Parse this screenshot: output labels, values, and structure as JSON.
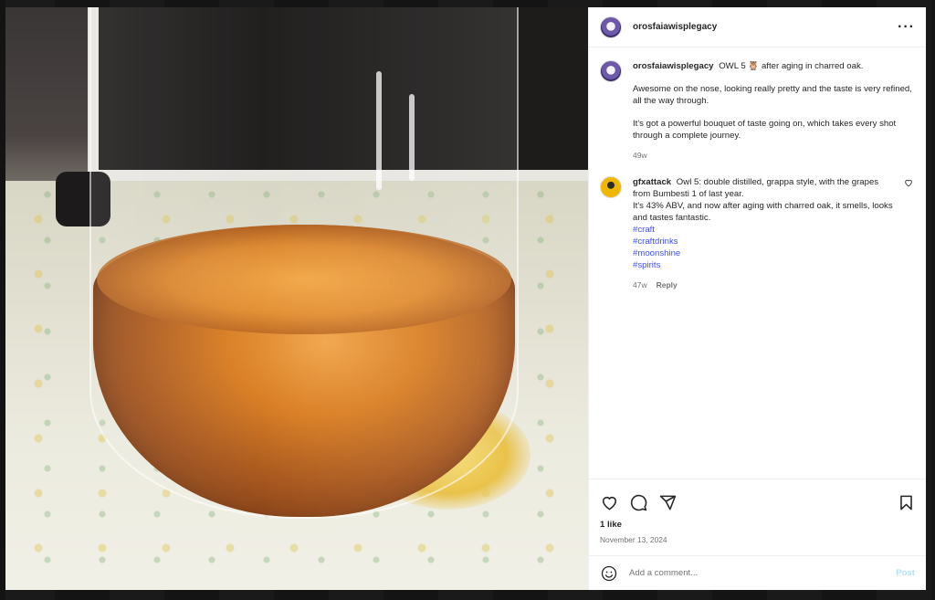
{
  "post": {
    "author": "orosfaiawisplegacy",
    "caption": {
      "title_text": "OWL 5 🦉 after aging in charred oak.",
      "paragraph_1": "Awesome on the nose, looking really pretty and the taste is very refined, all the way through.",
      "paragraph_2": "It's got a powerful bouquet of taste going on, which takes every shot through a complete journey.",
      "time": "49w"
    },
    "comments": [
      {
        "author": "gfxattack",
        "line_1": "Owl 5: double distilled, grappa style, with the grapes from Bumbesti 1 of last year.",
        "line_2": "It's 43% ABV, and now after aging with charred oak, it smells, looks and tastes fantastic.",
        "hashtags": [
          "#craft",
          "#craftdrinks",
          "#moonshine",
          "#spirits"
        ],
        "time": "47w",
        "reply_label": "Reply"
      }
    ],
    "likes": "1 like",
    "date": "November 13, 2024"
  },
  "composer": {
    "placeholder": "Add a comment...",
    "post_label": "Post"
  },
  "icons": {
    "more": "more-options-icon",
    "like": "heart-icon",
    "comment": "comment-icon",
    "share": "share-icon",
    "save": "bookmark-icon",
    "emoji": "emoji-icon"
  },
  "colors": {
    "hashtag": "#4150f7",
    "post_button": "#b2dffc",
    "muted": "#737373"
  }
}
